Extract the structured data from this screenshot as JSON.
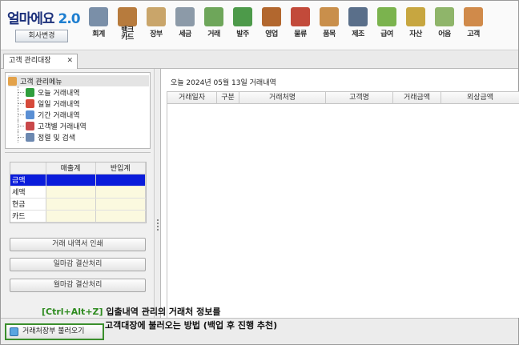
{
  "app": {
    "brand_name": "얼마에요",
    "brand_version": "2.0",
    "company_button": "회사변경"
  },
  "toolbar": [
    {
      "label": "회계",
      "icon": "calculator-icon",
      "color": "#7a8fa8"
    },
    {
      "label": "뱅크\n카드",
      "icon": "bank-icon",
      "color": "#b77b3d"
    },
    {
      "label": "장부",
      "icon": "ledger-icon",
      "color": "#c9a56a"
    },
    {
      "label": "세금",
      "icon": "tax-invoice-icon",
      "color": "#8c9aa8"
    },
    {
      "label": "거래",
      "icon": "transaction-icon",
      "color": "#6ea65a"
    },
    {
      "label": "발주",
      "icon": "order-icon",
      "color": "#4d9a4a"
    },
    {
      "label": "영업",
      "icon": "briefcase-icon",
      "color": "#b2672e"
    },
    {
      "label": "물류",
      "icon": "truck-icon",
      "color": "#c24a3a"
    },
    {
      "label": "품목",
      "icon": "box-icon",
      "color": "#c98f4b"
    },
    {
      "label": "제조",
      "icon": "tools-icon",
      "color": "#5a6f8a"
    },
    {
      "label": "급여",
      "icon": "payroll-icon",
      "color": "#7bb34e"
    },
    {
      "label": "자산",
      "icon": "money-bag-icon",
      "color": "#c7a640"
    },
    {
      "label": "어음",
      "icon": "bill-icon",
      "color": "#8fb56a"
    },
    {
      "label": "고객",
      "icon": "customers-icon",
      "color": "#d08a4a"
    }
  ],
  "tab": {
    "label": "고객 관리대장",
    "close": "✕"
  },
  "tree": {
    "root": "고객 관리메뉴",
    "items": [
      "오늘 거래내역",
      "일일 거래내역",
      "기간 거래내역",
      "고객별 거래내역",
      "정렬 및 검색"
    ],
    "item_colors": [
      "#2f9e3d",
      "#d64a3a",
      "#5a8fd4",
      "#c9484a",
      "#6c88b0"
    ]
  },
  "summary": {
    "headers": [
      "",
      "매출계",
      "반입계"
    ],
    "rows": [
      "금액",
      "세액",
      "현금",
      "카드"
    ]
  },
  "buttons": {
    "print": "거래 내역서 인쇄",
    "daily_close": "일마감 결산처리",
    "monthly_close": "월마감 결산처리"
  },
  "main": {
    "title": "오늘 2024년 05월 13일 거래내역",
    "columns": [
      "거래일자",
      "구분",
      "거래처명",
      "고객명",
      "거래금액",
      "외상금액"
    ]
  },
  "bottom": {
    "load_button": "거래처장부 불러오기",
    "note_key": "[Ctrl+Alt+Z]",
    "note_line1": "입출내역 관리의 거래처 정보를",
    "note_line2": "고객대장에 불러오는 방법 (백업 후 진행 추천)"
  }
}
